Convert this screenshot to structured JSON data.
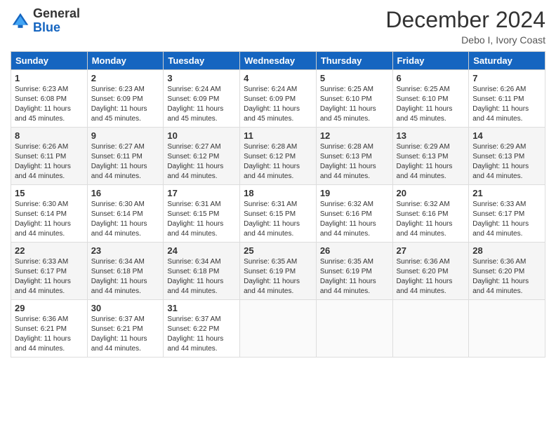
{
  "header": {
    "logo_line1": "General",
    "logo_line2": "Blue",
    "month": "December 2024",
    "location": "Debo I, Ivory Coast"
  },
  "days_of_week": [
    "Sunday",
    "Monday",
    "Tuesday",
    "Wednesday",
    "Thursday",
    "Friday",
    "Saturday"
  ],
  "weeks": [
    [
      {
        "day": "1",
        "info": "Sunrise: 6:23 AM\nSunset: 6:08 PM\nDaylight: 11 hours and 45 minutes."
      },
      {
        "day": "2",
        "info": "Sunrise: 6:23 AM\nSunset: 6:09 PM\nDaylight: 11 hours and 45 minutes."
      },
      {
        "day": "3",
        "info": "Sunrise: 6:24 AM\nSunset: 6:09 PM\nDaylight: 11 hours and 45 minutes."
      },
      {
        "day": "4",
        "info": "Sunrise: 6:24 AM\nSunset: 6:09 PM\nDaylight: 11 hours and 45 minutes."
      },
      {
        "day": "5",
        "info": "Sunrise: 6:25 AM\nSunset: 6:10 PM\nDaylight: 11 hours and 45 minutes."
      },
      {
        "day": "6",
        "info": "Sunrise: 6:25 AM\nSunset: 6:10 PM\nDaylight: 11 hours and 45 minutes."
      },
      {
        "day": "7",
        "info": "Sunrise: 6:26 AM\nSunset: 6:11 PM\nDaylight: 11 hours and 44 minutes."
      }
    ],
    [
      {
        "day": "8",
        "info": "Sunrise: 6:26 AM\nSunset: 6:11 PM\nDaylight: 11 hours and 44 minutes."
      },
      {
        "day": "9",
        "info": "Sunrise: 6:27 AM\nSunset: 6:11 PM\nDaylight: 11 hours and 44 minutes."
      },
      {
        "day": "10",
        "info": "Sunrise: 6:27 AM\nSunset: 6:12 PM\nDaylight: 11 hours and 44 minutes."
      },
      {
        "day": "11",
        "info": "Sunrise: 6:28 AM\nSunset: 6:12 PM\nDaylight: 11 hours and 44 minutes."
      },
      {
        "day": "12",
        "info": "Sunrise: 6:28 AM\nSunset: 6:13 PM\nDaylight: 11 hours and 44 minutes."
      },
      {
        "day": "13",
        "info": "Sunrise: 6:29 AM\nSunset: 6:13 PM\nDaylight: 11 hours and 44 minutes."
      },
      {
        "day": "14",
        "info": "Sunrise: 6:29 AM\nSunset: 6:13 PM\nDaylight: 11 hours and 44 minutes."
      }
    ],
    [
      {
        "day": "15",
        "info": "Sunrise: 6:30 AM\nSunset: 6:14 PM\nDaylight: 11 hours and 44 minutes."
      },
      {
        "day": "16",
        "info": "Sunrise: 6:30 AM\nSunset: 6:14 PM\nDaylight: 11 hours and 44 minutes."
      },
      {
        "day": "17",
        "info": "Sunrise: 6:31 AM\nSunset: 6:15 PM\nDaylight: 11 hours and 44 minutes."
      },
      {
        "day": "18",
        "info": "Sunrise: 6:31 AM\nSunset: 6:15 PM\nDaylight: 11 hours and 44 minutes."
      },
      {
        "day": "19",
        "info": "Sunrise: 6:32 AM\nSunset: 6:16 PM\nDaylight: 11 hours and 44 minutes."
      },
      {
        "day": "20",
        "info": "Sunrise: 6:32 AM\nSunset: 6:16 PM\nDaylight: 11 hours and 44 minutes."
      },
      {
        "day": "21",
        "info": "Sunrise: 6:33 AM\nSunset: 6:17 PM\nDaylight: 11 hours and 44 minutes."
      }
    ],
    [
      {
        "day": "22",
        "info": "Sunrise: 6:33 AM\nSunset: 6:17 PM\nDaylight: 11 hours and 44 minutes."
      },
      {
        "day": "23",
        "info": "Sunrise: 6:34 AM\nSunset: 6:18 PM\nDaylight: 11 hours and 44 minutes."
      },
      {
        "day": "24",
        "info": "Sunrise: 6:34 AM\nSunset: 6:18 PM\nDaylight: 11 hours and 44 minutes."
      },
      {
        "day": "25",
        "info": "Sunrise: 6:35 AM\nSunset: 6:19 PM\nDaylight: 11 hours and 44 minutes."
      },
      {
        "day": "26",
        "info": "Sunrise: 6:35 AM\nSunset: 6:19 PM\nDaylight: 11 hours and 44 minutes."
      },
      {
        "day": "27",
        "info": "Sunrise: 6:36 AM\nSunset: 6:20 PM\nDaylight: 11 hours and 44 minutes."
      },
      {
        "day": "28",
        "info": "Sunrise: 6:36 AM\nSunset: 6:20 PM\nDaylight: 11 hours and 44 minutes."
      }
    ],
    [
      {
        "day": "29",
        "info": "Sunrise: 6:36 AM\nSunset: 6:21 PM\nDaylight: 11 hours and 44 minutes."
      },
      {
        "day": "30",
        "info": "Sunrise: 6:37 AM\nSunset: 6:21 PM\nDaylight: 11 hours and 44 minutes."
      },
      {
        "day": "31",
        "info": "Sunrise: 6:37 AM\nSunset: 6:22 PM\nDaylight: 11 hours and 44 minutes."
      },
      {
        "day": "",
        "info": ""
      },
      {
        "day": "",
        "info": ""
      },
      {
        "day": "",
        "info": ""
      },
      {
        "day": "",
        "info": ""
      }
    ]
  ]
}
